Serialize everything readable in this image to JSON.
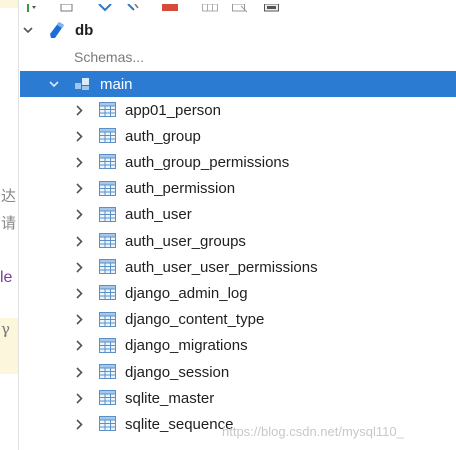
{
  "colors": {
    "selection": "#2c7bd3",
    "db_icon": "#1a6fd6",
    "table_icon": "#5b8fc7"
  },
  "gutter": {
    "glyphs": [
      "达",
      "请"
    ],
    "word": "le",
    "mark": "γ"
  },
  "tree": {
    "database": {
      "label": "db",
      "icon": "database-icon"
    },
    "schemas_label": "Schemas...",
    "schema": {
      "label": "main",
      "icon": "schema-icon"
    },
    "tables": [
      "app01_person",
      "auth_group",
      "auth_group_permissions",
      "auth_permission",
      "auth_user",
      "auth_user_groups",
      "auth_user_user_permissions",
      "django_admin_log",
      "django_content_type",
      "django_migrations",
      "django_session",
      "sqlite_master",
      "sqlite_sequence"
    ]
  },
  "watermark": "https://blog.csdn.net/mysql110_"
}
